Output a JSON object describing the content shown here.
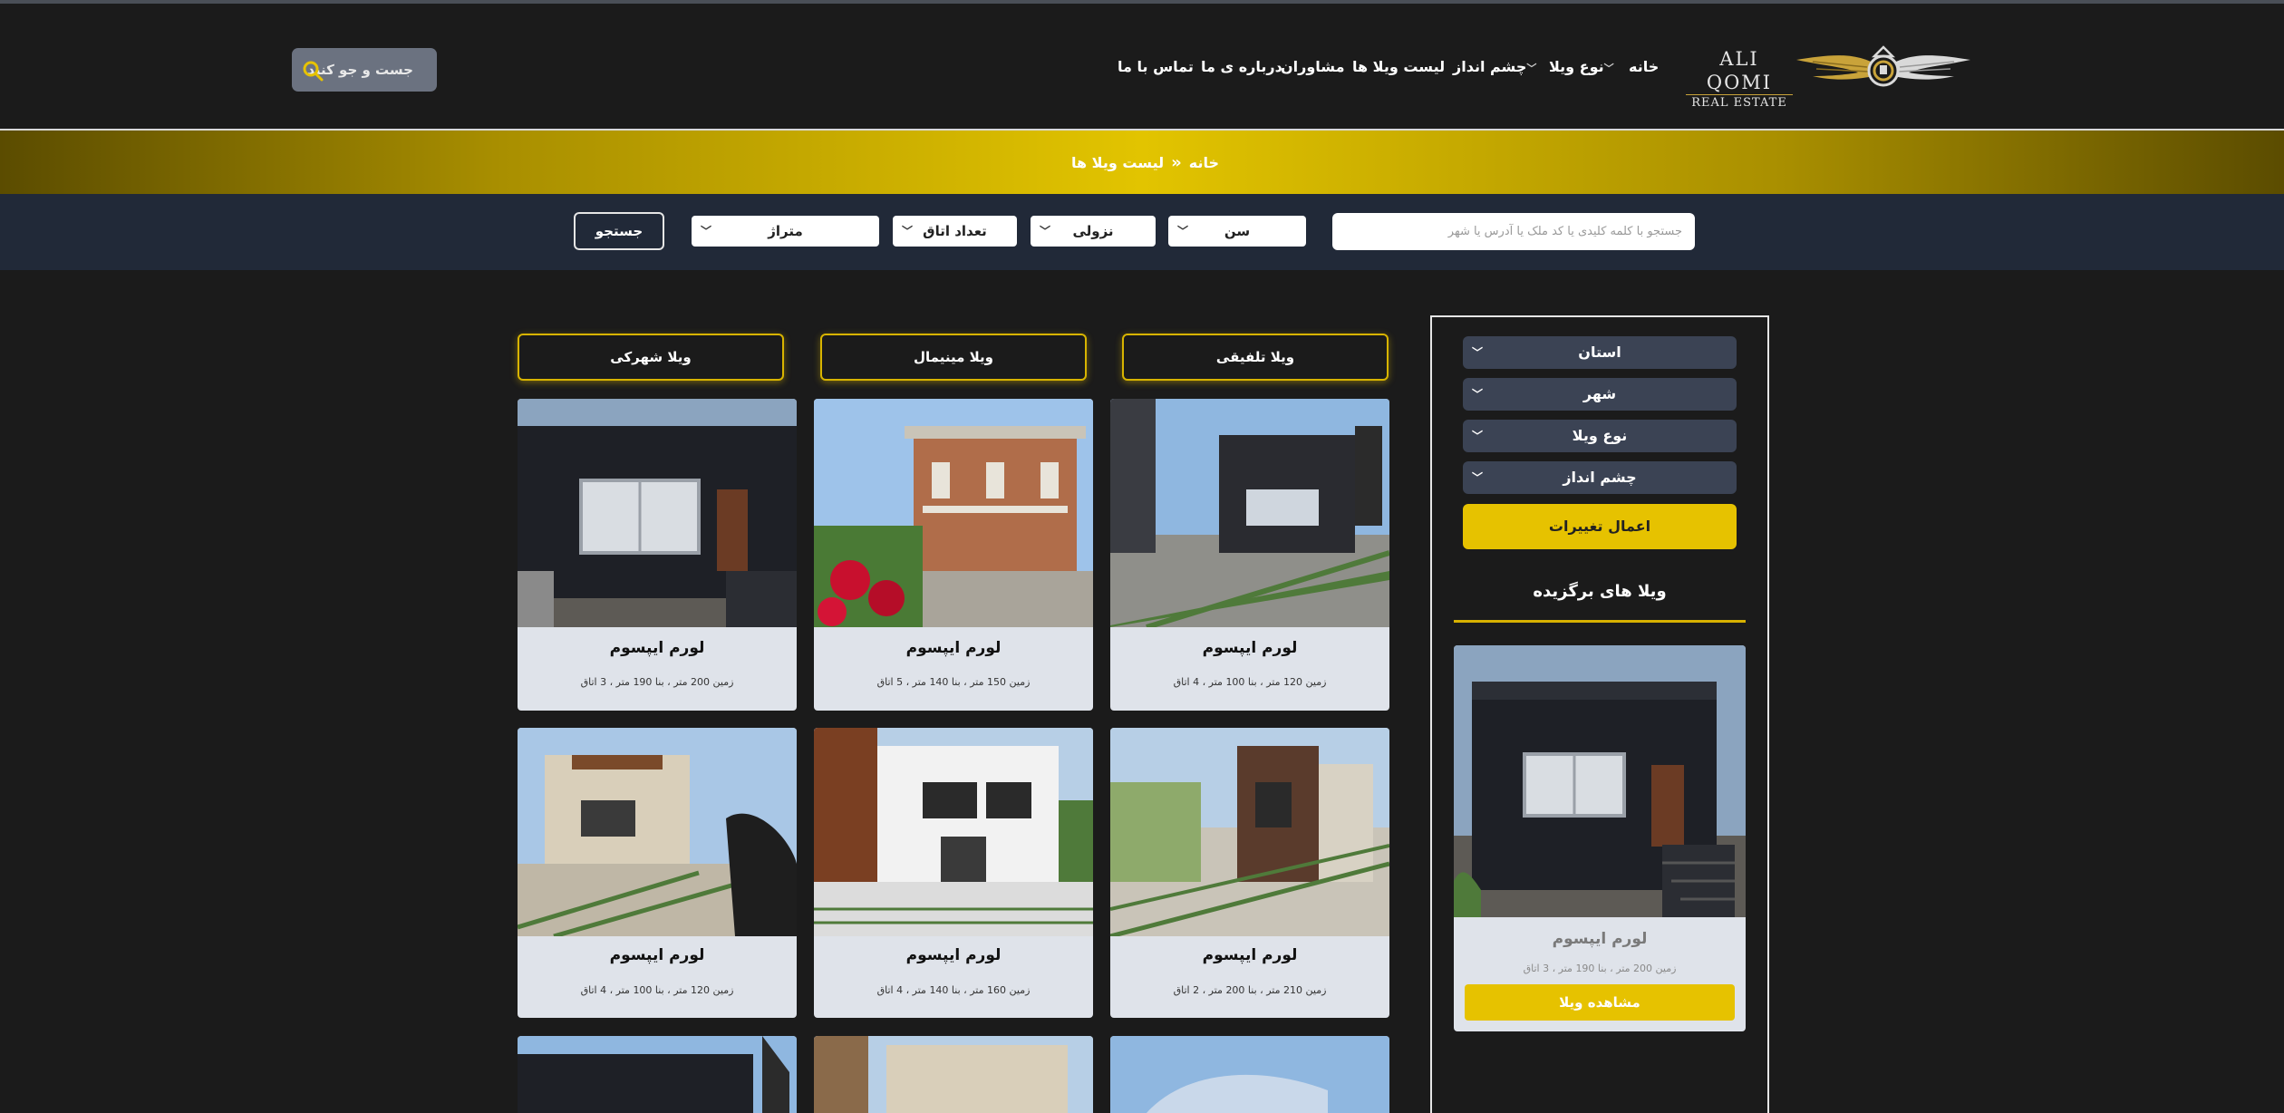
{
  "brand": {
    "line1": "ALI QOMI",
    "line2": "REAL ESTATE"
  },
  "nav": {
    "home": "خانه",
    "villa_type": "نوع ویلا",
    "view": "چشم انداز",
    "villa_list": "لیست ویلا ها",
    "consultants": "مشاوران",
    "about": "درباره ی ما",
    "contact": "تماس با ما"
  },
  "header_search": {
    "label": "جست و جو کنید"
  },
  "breadcrumb": {
    "home": "خانه",
    "current": "لیست ویلا ها"
  },
  "filters": {
    "search_placeholder": "جستجو با کلمه کلیدی یا کد ملک یا آدرس یا شهر",
    "age": "سن",
    "order": "نزولی",
    "rooms": "تعداد اتاق",
    "area": "متراژ",
    "search_button": "جستجو"
  },
  "sidebar": {
    "province": "استان",
    "city": "شهر",
    "villa_type": "نوع ویلا",
    "view": "چشم انداز",
    "apply": "اعمال تغییرات",
    "featured_heading": "ویلا های برگزیده",
    "featured": {
      "title": "لورم ایپسوم",
      "meta": "زمین 200 متر ، بنا 190 متر ، 3 اتاق",
      "button": "مشاهده ویلا"
    }
  },
  "categories": [
    "ویلا تلفیقی",
    "ویلا مینیمال",
    "ویلا شهرکی"
  ],
  "cards": [
    {
      "title": "لورم ایپسوم",
      "meta": "زمین 120 متر ، بنا 100 متر ، 4 اتاق"
    },
    {
      "title": "لورم ایپسوم",
      "meta": "زمین 150 متر ، بنا 140 متر ، 5 اتاق"
    },
    {
      "title": "لورم ایپسوم",
      "meta": "زمین 200 متر ، بنا 190 متر ، 3 اتاق"
    },
    {
      "title": "لورم ایپسوم",
      "meta": "زمین 210 متر ، بنا 200 متر ، 2 اتاق"
    },
    {
      "title": "لورم ایپسوم",
      "meta": "زمین 160 متر ، بنا 140 متر ، 4 اتاق"
    },
    {
      "title": "لورم ایپسوم",
      "meta": "زمین 120 متر ، بنا 100 متر ، 4 اتاق"
    }
  ],
  "colors": {
    "accent": "#e6c200",
    "dark_bg": "#1b1b1b",
    "filter_bg": "#212938",
    "card_bg": "#dfe3ea"
  }
}
